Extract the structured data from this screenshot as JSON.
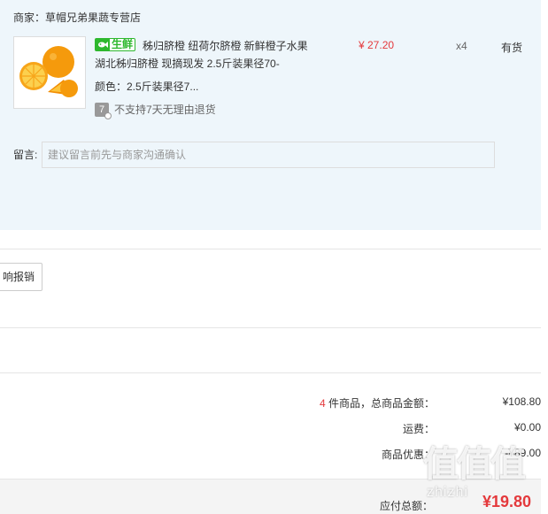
{
  "shop": {
    "name": "商家：草帽兄弟果蔬专营店"
  },
  "product": {
    "tag": "生鲜",
    "title": "秭归脐橙 纽荷尔脐橙 新鲜橙子水果 湖北秭归脐橙 现摘现发 2.5斤装果径70-",
    "sku": "颜色：2.5斤装果径7...",
    "return_policy": "不支持7天无理由退货",
    "return_icon_text": "7",
    "price": "¥ 27.20",
    "quantity": "x4",
    "stock": "有货"
  },
  "remark": {
    "label": "留言:",
    "placeholder": "建议留言前先与商家沟通确认"
  },
  "reimburse": {
    "label": "响报销"
  },
  "summary": {
    "count": "4",
    "count_suffix": " 件商品，总商品金额：",
    "total_goods_value": "¥108.80",
    "shipping_label": "运费：",
    "shipping_value": "¥0.00",
    "discount_label": "商品优惠：",
    "discount_value": "-¥89.00"
  },
  "total": {
    "label": "应付总额：",
    "value": "¥19.80"
  },
  "watermark": {
    "glyphs": "值值值",
    "text": "zhizhi"
  },
  "colors": {
    "panel_bg": "#eef6fb",
    "price_red": "#e4393c",
    "fresh_green": "#2eb82e"
  }
}
